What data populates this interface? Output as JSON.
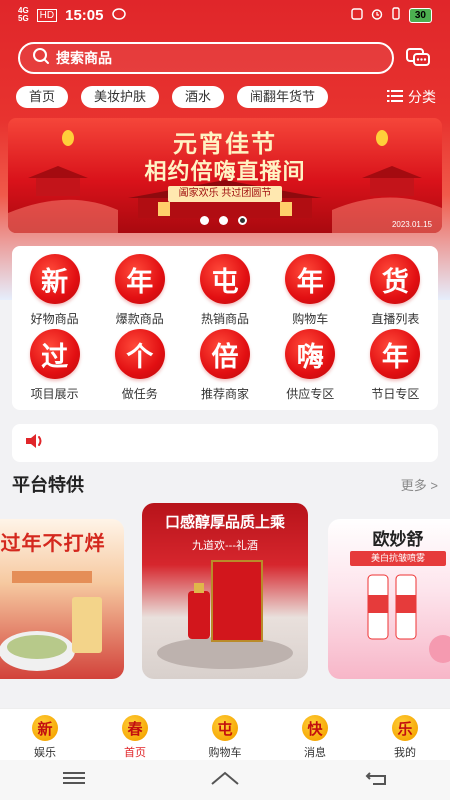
{
  "status_bar": {
    "signal_1": "4G",
    "signal_2": "5G",
    "carrier_badge": "HD",
    "time": "15:05",
    "battery": "30"
  },
  "search": {
    "placeholder": "搜索商品"
  },
  "categories": {
    "chips": [
      "首页",
      "美妆护肤",
      "酒水",
      "闹翻年货节"
    ],
    "all_label": "分类"
  },
  "banner": {
    "title": "元宵佳节",
    "subtitle": "相约倍嗨直播间",
    "tagline": "阖家欢乐 共过团圆节",
    "date": "2023.01.15"
  },
  "grid": [
    {
      "glyph": "新",
      "label": "好物商品"
    },
    {
      "glyph": "年",
      "label": "爆款商品"
    },
    {
      "glyph": "屯",
      "label": "热销商品"
    },
    {
      "glyph": "年",
      "label": "购物车"
    },
    {
      "glyph": "货",
      "label": "直播列表"
    },
    {
      "glyph": "过",
      "label": "项目展示"
    },
    {
      "glyph": "个",
      "label": "做任务"
    },
    {
      "glyph": "倍",
      "label": "推荐商家"
    },
    {
      "glyph": "嗨",
      "label": "供应专区"
    },
    {
      "glyph": "年",
      "label": "节日专区"
    }
  ],
  "section": {
    "title": "平台特供",
    "more": "更多 >"
  },
  "products": [
    {
      "headline": "过年不打烊"
    },
    {
      "headline": "口感醇厚品质上乘",
      "sub": "九道欢---礼酒"
    },
    {
      "headline": "欧妙舒",
      "sub": "美白抗皱喷雾"
    }
  ],
  "tabbar": [
    {
      "glyph": "新",
      "label": "娱乐"
    },
    {
      "glyph": "春",
      "label": "首页"
    },
    {
      "glyph": "屯",
      "label": "购物车"
    },
    {
      "glyph": "快",
      "label": "消息"
    },
    {
      "glyph": "乐",
      "label": "我的"
    }
  ],
  "colors": {
    "primary_red": "#e0262a",
    "gold": "#f5a400"
  }
}
